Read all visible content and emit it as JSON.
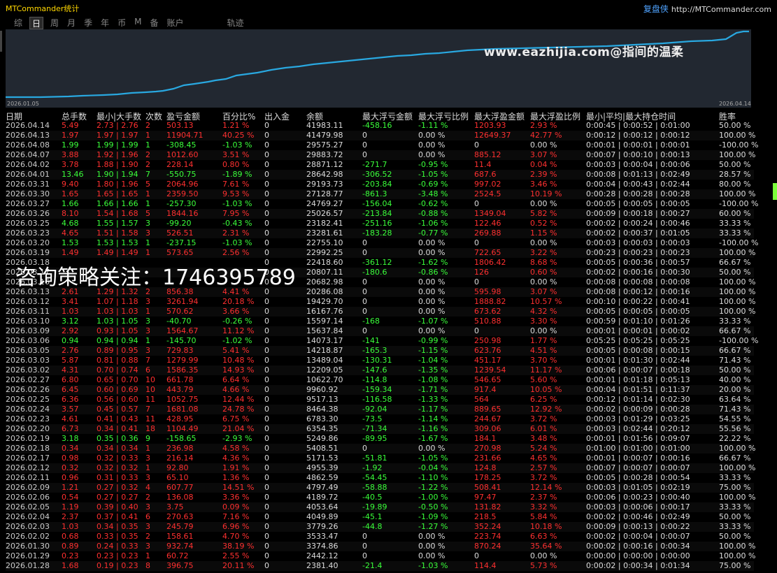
{
  "app": {
    "title": "MTCommander统计",
    "brand_label": "复盘侠",
    "brand_url": "http://MTCommander.com"
  },
  "tabs": [
    "综",
    "日",
    "周",
    "月",
    "季",
    "年",
    "币",
    "M",
    "备",
    "账户",
    "轨迹"
  ],
  "active_tab": "日",
  "chart": {
    "start_date": "2026.01.05",
    "end_date": "2026.04.14",
    "line_color": "#29a8e0"
  },
  "chart_data": {
    "type": "line",
    "description_note": "",
    "x": [
      "2026.01.05",
      "2026.04.14"
    ],
    "values": []
  },
  "watermarks": {
    "site": "www.eazhijia.com@指间的温柔",
    "consult": "咨询策略关注：1746395789"
  },
  "columns": [
    "日期",
    "总手数",
    "最小|大手数",
    "次数",
    "盈亏金额",
    "百分比%",
    "出入金",
    "余额",
    "最大浮亏金额",
    "最大浮亏比例",
    "最大浮盈金额",
    "最大浮盈比例",
    "最小|平均|最大持仓时间",
    "胜率"
  ],
  "rows": [
    [
      "2026.04.14",
      "5.49",
      "2.73 | 2.76",
      "2",
      "503.13",
      "1.21 %",
      "0",
      "41983.11",
      "-458.16",
      "-1.11 %",
      "1203.93",
      "2.93 %",
      "0:00:45 | 0:00:52 | 0:01:00",
      "50.00 %",
      "r"
    ],
    [
      "2026.04.13",
      "1.97",
      "1.97 | 1.97",
      "1",
      "11904.71",
      "40.25 %",
      "0",
      "41479.98",
      "0",
      "0.00 %",
      "12649.37",
      "42.77 %",
      "0:00:12 | 0:00:12 | 0:00:12",
      "100.00 %",
      "r"
    ],
    [
      "2026.04.08",
      "1.99",
      "1.99 | 1.99",
      "1",
      "-308.45",
      "-1.03 %",
      "0",
      "29575.27",
      "0",
      "0.00 %",
      "0",
      "0.00 %",
      "0:00:01 | 0:00:01 | 0:00:01",
      "-100.00 %",
      "g"
    ],
    [
      "2026.04.07",
      "3.88",
      "1.92 | 1.96",
      "2",
      "1012.60",
      "3.51 %",
      "0",
      "29883.72",
      "0",
      "0.00 %",
      "885.12",
      "3.07 %",
      "0:00:07 | 0:00:10 | 0:00:13",
      "100.00 %",
      "r"
    ],
    [
      "2026.04.02",
      "3.78",
      "1.88 | 1.90",
      "2",
      "228.14",
      "0.80 %",
      "0",
      "28871.12",
      "-271.7",
      "-0.95 %",
      "11.4",
      "0.04 %",
      "0:00:03 | 0:00:04 | 0:00:06",
      "50.00 %",
      "r"
    ],
    [
      "2026.04.01",
      "13.46",
      "1.90 | 1.94",
      "7",
      "-550.75",
      "-1.89 %",
      "0",
      "28642.98",
      "-306.52",
      "-1.05 %",
      "687.6",
      "2.39 %",
      "0:00:08 | 0:01:13 | 0:02:49",
      "28.57 %",
      "g"
    ],
    [
      "2026.03.31",
      "9.40",
      "1.80 | 1.96",
      "5",
      "2064.96",
      "7.61 %",
      "0",
      "29193.73",
      "-203.84",
      "-0.69 %",
      "997.02",
      "3.46 %",
      "0:00:04 | 0:00:43 | 0:02:44",
      "80.00 %",
      "r"
    ],
    [
      "2026.03.30",
      "1.65",
      "1.65 | 1.65",
      "1",
      "2359.50",
      "9.53 %",
      "0",
      "27128.77",
      "-861.3",
      "-3.48 %",
      "2524.5",
      "10.19 %",
      "0:00:28 | 0:00:28 | 0:00:28",
      "100.00 %",
      "r"
    ],
    [
      "2026.03.27",
      "1.66",
      "1.66 | 1.66",
      "1",
      "-257.30",
      "-1.03 %",
      "0",
      "24769.27",
      "-156.04",
      "-0.62 %",
      "0",
      "0.00 %",
      "0:00:05 | 0:00:05 | 0:00:05",
      "-100.00 %",
      "g"
    ],
    [
      "2026.03.26",
      "8.10",
      "1.54 | 1.68",
      "5",
      "1844.16",
      "7.95 %",
      "0",
      "25026.57",
      "-213.84",
      "-0.88 %",
      "1349.04",
      "5.82 %",
      "0:00:09 | 0:00:18 | 0:00:27",
      "60.00 %",
      "r"
    ],
    [
      "2026.03.25",
      "4.68",
      "1.55 | 1.57",
      "3",
      "-99.20",
      "-0.43 %",
      "0",
      "23182.41",
      "-251.16",
      "-1.06 %",
      "122.46",
      "0.52 %",
      "0:00:02 | 0:00:24 | 0:00:46",
      "33.33 %",
      "g"
    ],
    [
      "2026.03.23",
      "4.65",
      "1.51 | 1.58",
      "3",
      "526.51",
      "2.31 %",
      "0",
      "23281.61",
      "-183.28",
      "-0.77 %",
      "269.88",
      "1.15 %",
      "0:00:02 | 0:00:37 | 0:01:05",
      "33.33 %",
      "r"
    ],
    [
      "2026.03.20",
      "1.53",
      "1.53 | 1.53",
      "1",
      "-237.15",
      "-1.03 %",
      "0",
      "22755.10",
      "0",
      "0.00 %",
      "0",
      "0.00 %",
      "0:00:03 | 0:00:03 | 0:00:03",
      "-100.00 %",
      "g"
    ],
    [
      "2026.03.19",
      "1.49",
      "1.49 | 1.49",
      "1",
      "573.65",
      "2.56 %",
      "0",
      "22992.25",
      "0",
      "0.00 %",
      "722.65",
      "3.22 %",
      "0:00:23 | 0:00:23 | 0:00:23",
      "100.00 %",
      "r"
    ],
    [
      "2026.03.18",
      "",
      "",
      "",
      "",
      "",
      "0",
      "22418.60",
      "-361.12",
      "-1.62 %",
      "1806.42",
      "8.68 %",
      "0:00:05 | 0:00:36 | 0:00:57",
      "66.67 %",
      "r"
    ],
    [
      "2026.03.17",
      "",
      "",
      "",
      "",
      "",
      "0",
      "20807.11",
      "-180.6",
      "-0.86 %",
      "126",
      "0.60 %",
      "0:00:02 | 0:00:16 | 0:00:30",
      "50.00 %",
      "r"
    ],
    [
      "2026.03.16",
      "",
      "",
      "",
      "",
      "",
      "0",
      "20682.98",
      "0",
      "0.00 %",
      "0",
      "0.00 %",
      "0:00:08 | 0:00:08 | 0:00:08",
      "100.00 %",
      "r"
    ],
    [
      "2026.03.13",
      "2.61",
      "1.29 | 1.32",
      "2",
      "856.38",
      "4.41 %",
      "0",
      "20286.08",
      "0",
      "0.00 %",
      "595.98",
      "3.07 %",
      "0:00:08 | 0:00:12 | 0:00:16",
      "100.00 %",
      "r"
    ],
    [
      "2026.03.12",
      "3.41",
      "1.07 | 1.18",
      "3",
      "3261.94",
      "20.18 %",
      "0",
      "19429.70",
      "0",
      "0.00 %",
      "1888.82",
      "10.57 %",
      "0:00:10 | 0:00:22 | 0:00:41",
      "100.00 %",
      "r"
    ],
    [
      "2026.03.11",
      "1.03",
      "1.03 | 1.03",
      "1",
      "570.62",
      "3.66 %",
      "0",
      "16167.76",
      "0",
      "0.00 %",
      "673.62",
      "4.32 %",
      "0:00:05 | 0:00:05 | 0:00:05",
      "100.00 %",
      "r"
    ],
    [
      "2026.03.10",
      "3.12",
      "1.03 | 1.05",
      "3",
      "-40.70",
      "-0.26 %",
      "0",
      "15597.14",
      "-168",
      "-1.07 %",
      "510.88",
      "3.30 %",
      "0:00:59 | 0:01:10 | 0:01:26",
      "33.33 %",
      "g"
    ],
    [
      "2026.03.09",
      "2.92",
      "0.93 | 1.05",
      "3",
      "1564.67",
      "11.12 %",
      "0",
      "15637.84",
      "0",
      "0.00 %",
      "0",
      "0.00 %",
      "0:00:01 | 0:00:01 | 0:00:02",
      "66.67 %",
      "r"
    ],
    [
      "2026.03.06",
      "0.94",
      "0.94 | 0.94",
      "1",
      "-145.70",
      "-1.02 %",
      "0",
      "14073.17",
      "-141",
      "-0.99 %",
      "250.98",
      "1.77 %",
      "0:05:25 | 0:05:25 | 0:05:25",
      "-100.00 %",
      "g"
    ],
    [
      "2026.03.05",
      "2.76",
      "0.89 | 0.95",
      "3",
      "729.83",
      "5.41 %",
      "0",
      "14218.87",
      "-165.3",
      "-1.15 %",
      "623.76",
      "4.51 %",
      "0:00:05 | 0:00:08 | 0:00:15",
      "66.67 %",
      "r"
    ],
    [
      "2026.03.03",
      "5.87",
      "0.81 | 0.88",
      "7",
      "1279.99",
      "10.48 %",
      "0",
      "13489.04",
      "-130.31",
      "-1.04 %",
      "451.17",
      "3.70 %",
      "0:00:01 | 0:01:30 | 0:02:44",
      "71.43 %",
      "r"
    ],
    [
      "2026.03.02",
      "4.31",
      "0.70 | 0.74",
      "6",
      "1586.35",
      "14.93 %",
      "0",
      "12209.05",
      "-147.6",
      "-1.35 %",
      "1239.54",
      "11.17 %",
      "0:00:06 | 0:00:07 | 0:00:18",
      "50.00 %",
      "r"
    ],
    [
      "2026.02.27",
      "6.80",
      "0.65 | 0.70",
      "10",
      "661.78",
      "6.64 %",
      "0",
      "10622.70",
      "-114.8",
      "-1.08 %",
      "546.65",
      "5.60 %",
      "0:00:01 | 0:01:18 | 0:05:13",
      "40.00 %",
      "r"
    ],
    [
      "2026.02.26",
      "6.45",
      "0.60 | 0.69",
      "10",
      "443.79",
      "4.66 %",
      "0",
      "9960.92",
      "-159.34",
      "-1.71 %",
      "917.4",
      "10.05 %",
      "0:00:04 | 0:01:51 | 0:11:37",
      "20.00 %",
      "r"
    ],
    [
      "2026.02.25",
      "6.36",
      "0.56 | 0.60",
      "11",
      "1052.75",
      "12.44 %",
      "0",
      "9517.13",
      "-116.58",
      "-1.33 %",
      "564",
      "6.25 %",
      "0:00:12 | 0:01:14 | 0:02:30",
      "63.64 %",
      "r"
    ],
    [
      "2026.02.24",
      "3.57",
      "0.45 | 0.57",
      "7",
      "1681.08",
      "24.78 %",
      "0",
      "8464.38",
      "-92.04",
      "-1.17 %",
      "889.65",
      "12.92 %",
      "0:00:02 | 0:00:09 | 0:00:28",
      "71.43 %",
      "r"
    ],
    [
      "2026.02.23",
      "4.61",
      "0.41 | 0.43",
      "11",
      "428.95",
      "6.75 %",
      "0",
      "6783.30",
      "-73.5",
      "-1.14 %",
      "244.67",
      "3.72 %",
      "0:00:03 | 0:01:29 | 0:03:25",
      "54.55 %",
      "r"
    ],
    [
      "2026.02.20",
      "6.73",
      "0.34 | 0.41",
      "18",
      "1104.49",
      "21.04 %",
      "0",
      "6354.35",
      "-71.34",
      "-1.16 %",
      "309.06",
      "6.01 %",
      "0:00:03 | 0:02:44 | 0:20:12",
      "55.56 %",
      "r"
    ],
    [
      "2026.02.19",
      "3.18",
      "0.35 | 0.36",
      "9",
      "-158.65",
      "-2.93 %",
      "0",
      "5249.86",
      "-89.95",
      "-1.67 %",
      "184.1",
      "3.48 %",
      "0:00:01 | 0:01:56 | 0:09:07",
      "22.22 %",
      "g"
    ],
    [
      "2026.02.18",
      "0.34",
      "0.34 | 0.34",
      "1",
      "236.98",
      "4.58 %",
      "0",
      "5408.51",
      "0",
      "0.00 %",
      "270.98",
      "5.24 %",
      "0:01:00 | 0:01:00 | 0:01:00",
      "100.00 %",
      "r"
    ],
    [
      "2026.02.17",
      "0.98",
      "0.32 | 0.33",
      "3",
      "216.14",
      "4.36 %",
      "0",
      "5171.53",
      "-51.81",
      "-1.05 %",
      "231.66",
      "4.65 %",
      "0:00:01 | 0:00:07 | 0:00:16",
      "66.67 %",
      "r"
    ],
    [
      "2026.02.12",
      "0.32",
      "0.32 | 0.32",
      "1",
      "92.80",
      "1.91 %",
      "0",
      "4955.39",
      "-1.92",
      "-0.04 %",
      "124.8",
      "2.57 %",
      "0:00:07 | 0:00:07 | 0:00:07",
      "100.00 %",
      "r"
    ],
    [
      "2026.02.11",
      "0.96",
      "0.31 | 0.33",
      "3",
      "65.10",
      "1.36 %",
      "0",
      "4862.59",
      "-54.45",
      "-1.10 %",
      "178.25",
      "3.72 %",
      "0:00:05 | 0:00:28 | 0:00:54",
      "33.33 %",
      "r"
    ],
    [
      "2026.02.09",
      "1.21",
      "0.27 | 0.32",
      "4",
      "607.77",
      "14.51 %",
      "0",
      "4797.49",
      "-58.88",
      "-1.22 %",
      "508.41",
      "12.14 %",
      "0:00:03 | 0:01:05 | 0:02:19",
      "75.00 %",
      "r"
    ],
    [
      "2026.02.06",
      "0.54",
      "0.27 | 0.27",
      "2",
      "136.08",
      "3.36 %",
      "0",
      "4189.72",
      "-40.5",
      "-1.00 %",
      "97.47",
      "2.37 %",
      "0:00:06 | 0:00:23 | 0:00:40",
      "100.00 %",
      "r"
    ],
    [
      "2026.02.05",
      "1.19",
      "0.39 | 0.40",
      "3",
      "3.75",
      "0.09 %",
      "0",
      "4053.64",
      "-19.89",
      "-0.50 %",
      "131.82",
      "3.32 %",
      "0:00:03 | 0:00:06 | 0:00:17",
      "33.33 %",
      "r"
    ],
    [
      "2026.02.04",
      "2.37",
      "0.37 | 0.41",
      "6",
      "270.63",
      "7.16 %",
      "0",
      "4049.89",
      "-45.1",
      "-1.09 %",
      "218.5",
      "5.84 %",
      "0:00:02 | 0:00:46 | 0:02:49",
      "50.00 %",
      "r"
    ],
    [
      "2026.02.03",
      "1.03",
      "0.34 | 0.35",
      "3",
      "245.79",
      "6.96 %",
      "0",
      "3779.26",
      "-44.8",
      "-1.27 %",
      "352.24",
      "10.18 %",
      "0:00:09 | 0:00:13 | 0:00:22",
      "33.33 %",
      "r"
    ],
    [
      "2026.02.02",
      "0.68",
      "0.33 | 0.35",
      "2",
      "158.61",
      "4.70 %",
      "0",
      "3533.47",
      "0",
      "0.00 %",
      "223.74",
      "6.63 %",
      "0:00:02 | 0:00:04 | 0:00:07",
      "50.00 %",
      "r"
    ],
    [
      "2026.01.30",
      "0.89",
      "0.24 | 0.33",
      "3",
      "932.74",
      "38.19 %",
      "0",
      "3374.86",
      "0",
      "0.00 %",
      "870.24",
      "35.64 %",
      "0:00:02 | 0:00:16 | 0:00:34",
      "100.00 %",
      "r"
    ],
    [
      "2026.01.29",
      "0.23",
      "0.23 | 0.23",
      "1",
      "60.72",
      "2.55 %",
      "0",
      "2442.12",
      "0",
      "0.00 %",
      "0",
      "0.00 %",
      "0:00:00 | 0:00:00 | 0:00:00",
      "100.00 %",
      "r"
    ],
    [
      "2026.01.28",
      "1.68",
      "0.19 | 0.23",
      "8",
      "396.75",
      "20.11 %",
      "0",
      "2381.40",
      "-21.4",
      "-1.03 %",
      "114.4",
      "5.73 %",
      "0:00:02 | 0:00:34 | 0:01:34",
      "75.00 %",
      "r"
    ]
  ]
}
